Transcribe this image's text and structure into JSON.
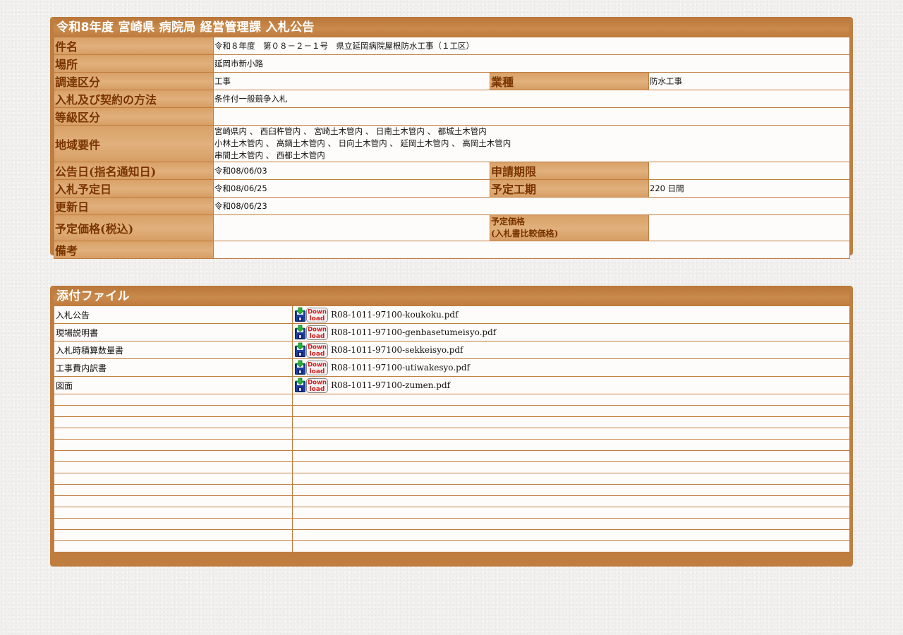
{
  "notice": {
    "title": "令和8年度 宮崎県 病院局 経営管理課 入札公告",
    "rows": {
      "subject_label": "件名",
      "subject_value": "令和８年度　第０８－２－１号　県立延岡病院屋根防水工事（１工区）",
      "location_label": "場所",
      "location_value": "延岡市新小路",
      "procurement_label": "調達区分",
      "procurement_value": "工事",
      "industry_label": "業種",
      "industry_value": "防水工事",
      "method_label": "入札及び契約の方法",
      "method_value": "条件付一般競争入札",
      "grade_label": "等級区分",
      "grade_value": "",
      "region_label": "地域要件",
      "region_lines": [
        "宮崎県内 、 西臼杵管内 、 宮崎土木管内 、 日南土木管内 、 都城土木管内",
        "小林土木管内 、 高鍋土木管内 、 日向土木管内 、 延岡土木管内 、 高岡土木管内",
        "串間土木管内 、 西都土木管内"
      ],
      "announce_label": "公告日(指名通知日)",
      "announce_value": "令和08/06/03",
      "apply_label": "申請期限",
      "apply_value": "",
      "bid_date_label": "入札予定日",
      "bid_date_value": "令和08/06/25",
      "term_label": "予定工期",
      "term_value": "220 日間",
      "updated_label": "更新日",
      "updated_value": "令和08/06/23",
      "price_label": "予定価格(税込)",
      "price_value": "",
      "price2_label_line1": "予定価格",
      "price2_label_line2": "(入札書比較価格)",
      "price2_value": "",
      "remarks_label": "備考",
      "remarks_value": ""
    }
  },
  "files": {
    "title": "添付ファイル",
    "download_icon": "download-floppy-icon",
    "items": [
      {
        "name": "入札公告",
        "file": "R08-1011-97100-koukoku.pdf"
      },
      {
        "name": "現場説明書",
        "file": "R08-1011-97100-genbasetumeisyo.pdf"
      },
      {
        "name": "入札時積算数量書",
        "file": "R08-1011-97100-sekkeisyo.pdf"
      },
      {
        "name": "工事費内訳書",
        "file": "R08-1011-97100-utiwakesyo.pdf"
      },
      {
        "name": "図面",
        "file": "R08-1011-97100-zumen.pdf"
      }
    ]
  },
  "colors": {
    "frame": "#c07d40",
    "label_text": "#7a3400",
    "label_bg": "#e1b07c",
    "cell_bg": "#fdfcfa"
  }
}
